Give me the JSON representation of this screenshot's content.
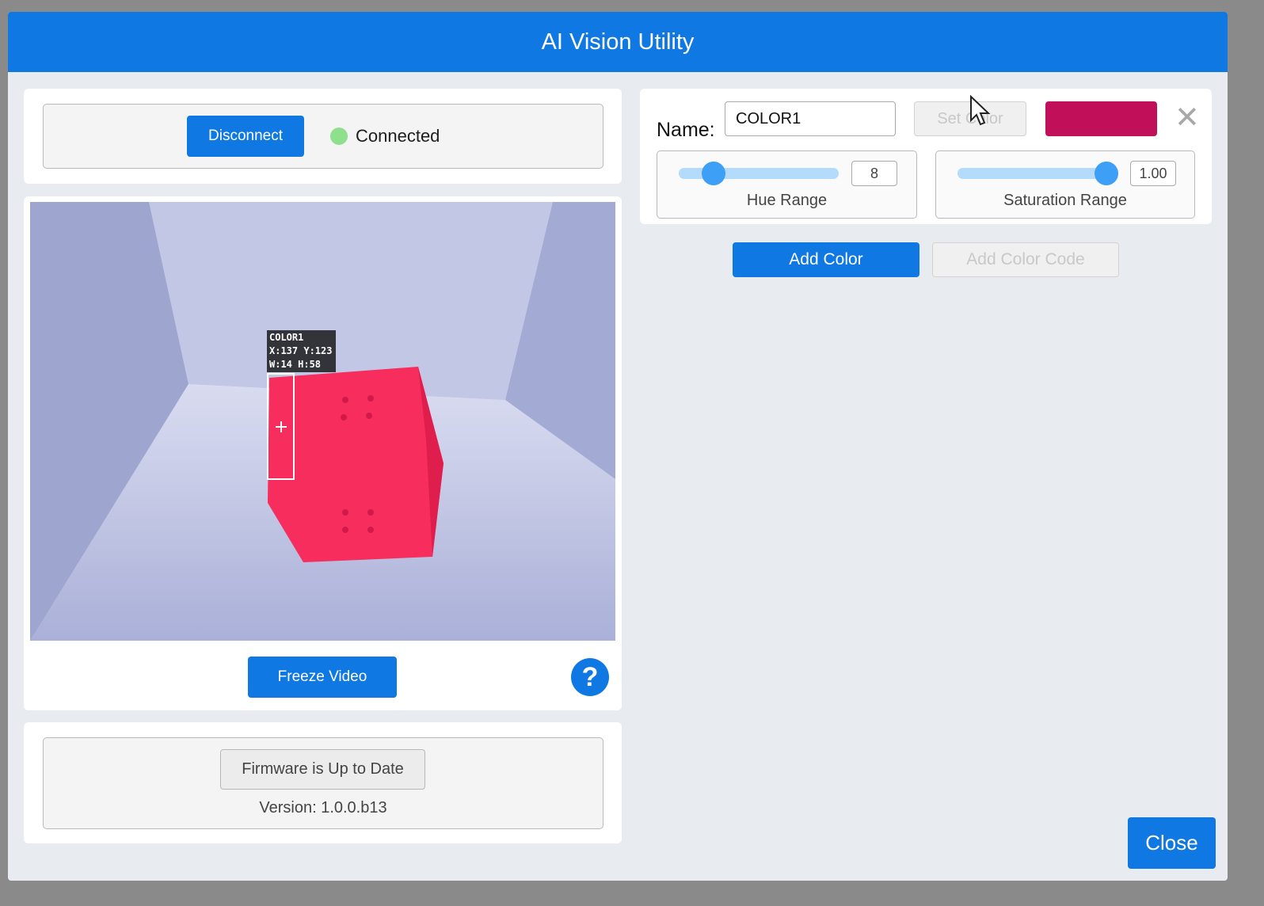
{
  "app": {
    "title": "AI Vision Utility"
  },
  "connection": {
    "disconnect_label": "Disconnect",
    "status_text": "Connected",
    "status_color": "#8fe08c"
  },
  "video": {
    "overlay_line1": "COLOR1",
    "overlay_line2": "X:137 Y:123",
    "overlay_line3": "W:14 H:58",
    "freeze_label": "Freeze Video",
    "help_symbol": "?"
  },
  "firmware": {
    "status_label": "Firmware is Up to Date",
    "version_text": "Version: 1.0.0.b13"
  },
  "color_config": {
    "name_label": "Name:",
    "name_value": "COLOR1",
    "set_color_label": "Set Color",
    "swatch_color": "#c20f5a",
    "remove_icon": "close-icon",
    "hue": {
      "label": "Hue Range",
      "value": "8",
      "fraction": 0.22
    },
    "saturation": {
      "label": "Saturation Range",
      "value": "1.00",
      "fraction": 0.93
    }
  },
  "actions": {
    "add_color_label": "Add Color",
    "add_color_code_label": "Add Color Code",
    "close_label": "Close"
  },
  "colors": {
    "accent": "#0f78e2",
    "title_bar": "#0f78e2",
    "background": "#e8ecf0"
  }
}
